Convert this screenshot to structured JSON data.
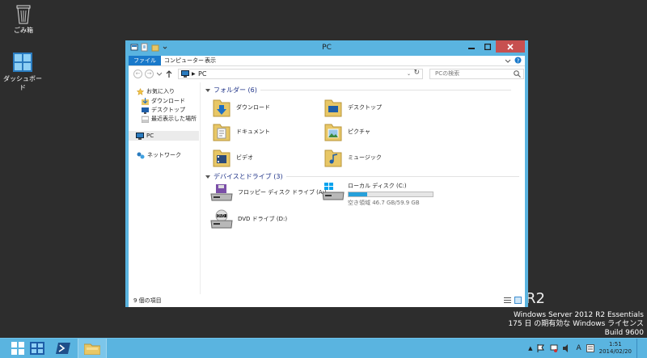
{
  "desktop": {
    "icons": [
      {
        "label": "ごみ箱",
        "icon": "recycle-bin-icon"
      },
      {
        "label": "ダッシュボード",
        "icon": "dashboard-icon"
      }
    ],
    "watermark": {
      "r2": "R2",
      "line1": "Windows Server 2012 R2 Essentials",
      "line2": "175 日 の期有効な Windows ライセンス",
      "line3": "Build 9600"
    }
  },
  "window": {
    "title": "PC",
    "tabs": [
      {
        "label": "ファイル",
        "active": true
      },
      {
        "label": "コンピューター",
        "active": false
      },
      {
        "label": "表示",
        "active": false
      }
    ],
    "address": "PC",
    "search_placeholder": "PCの検索",
    "nav": {
      "favorites": "お気に入り",
      "items": [
        "ダウンロード",
        "デスクトップ",
        "最近表示した場所"
      ],
      "pc": "PC",
      "network": "ネットワーク"
    },
    "folders_header": "フォルダー (6)",
    "folders": [
      {
        "label": "ダウンロード",
        "icon": "downloads-folder-icon"
      },
      {
        "label": "デスクトップ",
        "icon": "desktop-folder-icon"
      },
      {
        "label": "ドキュメント",
        "icon": "documents-folder-icon"
      },
      {
        "label": "ピクチャ",
        "icon": "pictures-folder-icon"
      },
      {
        "label": "ビデオ",
        "icon": "videos-folder-icon"
      },
      {
        "label": "ミュージック",
        "icon": "music-folder-icon"
      }
    ],
    "drives_header": "デバイスとドライブ (3)",
    "drives": [
      {
        "label": "フロッピー ディスク ドライブ (A:)",
        "icon": "floppy-drive-icon"
      },
      {
        "label": "ローカル ディスク (C:)",
        "sub": "空き領域 46.7 GB/59.9 GB",
        "icon": "local-disk-icon",
        "used_fraction": 0.22
      },
      {
        "label": "DVD ドライブ (D:)",
        "icon": "dvd-drive-icon"
      }
    ],
    "status": "9 個の項目"
  },
  "taskbar": {
    "time": "1:51",
    "date": "2014/02/20",
    "ime": "A"
  },
  "colors": {
    "accent": "#5ab4e0",
    "tab_active": "#1979ca",
    "close": "#c75050",
    "folder": "#e8c766",
    "header_text": "#1e3287",
    "disk_bar": "#26a0da"
  }
}
